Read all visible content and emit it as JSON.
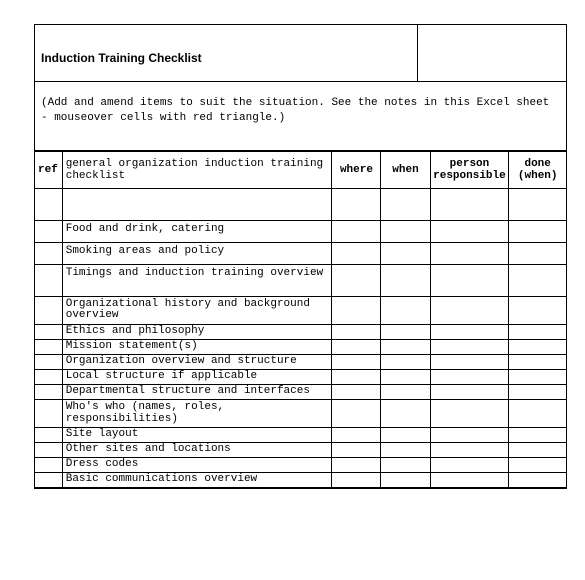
{
  "title": "Induction Training Checklist",
  "note": "(Add and amend items to suit the situation. See the notes in this Excel sheet - mouseover cells with red triangle.)",
  "headers": {
    "ref": "ref",
    "desc": "general organization induction training checklist",
    "where": "where",
    "when": "when",
    "person": "person responsible",
    "done": "done (when)"
  },
  "rows": [
    {
      "desc": "",
      "cls": "tall"
    },
    {
      "desc": "Food and drink, catering",
      "cls": "med"
    },
    {
      "desc": "Smoking areas and policy",
      "cls": "med"
    },
    {
      "desc": "Timings and induction training overview",
      "cls": "tall"
    },
    {
      "desc": "Organizational history and background overview",
      "cls": "twoln"
    },
    {
      "desc": "Ethics and philosophy",
      "cls": "short"
    },
    {
      "desc": "Mission statement(s)",
      "cls": "short"
    },
    {
      "desc": "Organization overview and structure",
      "cls": "short"
    },
    {
      "desc": "Local structure if applicable",
      "cls": "short"
    },
    {
      "desc": "Departmental structure and interfaces",
      "cls": "short"
    },
    {
      "desc": "Who's who (names, roles, responsibilities)",
      "cls": "twoln"
    },
    {
      "desc": "Site layout",
      "cls": "short"
    },
    {
      "desc": "Other sites and locations",
      "cls": "short"
    },
    {
      "desc": "Dress codes",
      "cls": "short"
    },
    {
      "desc": "Basic communications overview",
      "cls": "short"
    }
  ]
}
